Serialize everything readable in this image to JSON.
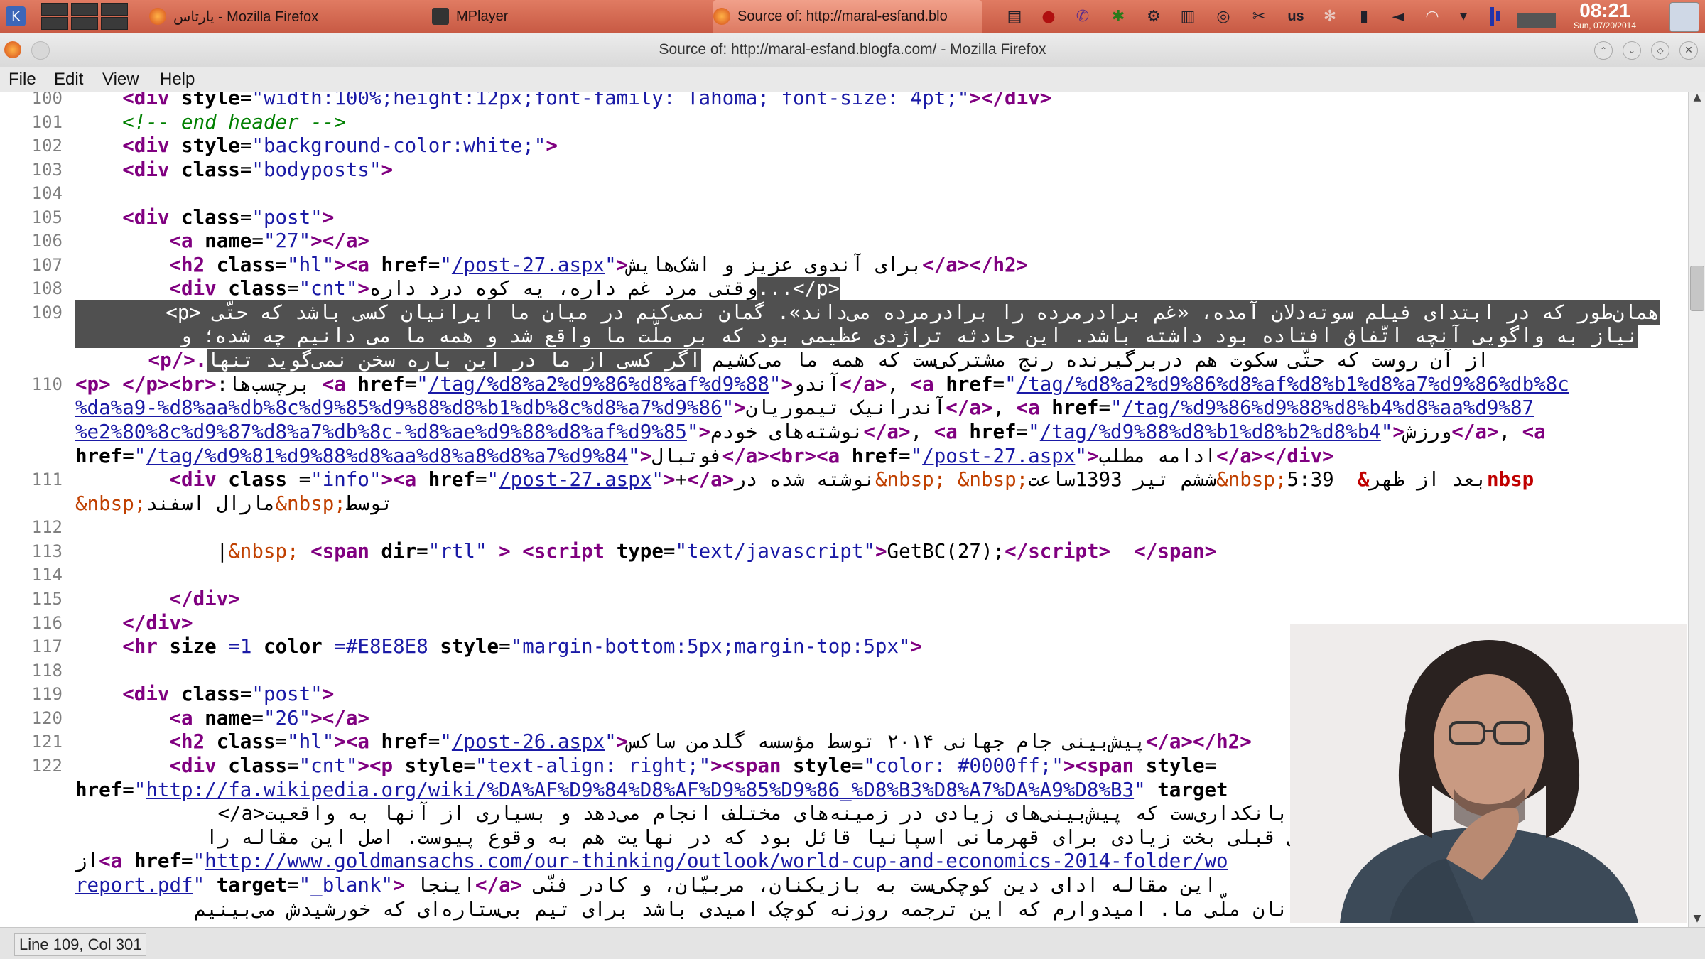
{
  "taskbar": {
    "tasks": [
      {
        "label": "یارتاس - Mozilla Firefox",
        "icon": "firefox-icon"
      },
      {
        "label": "MPlayer",
        "icon": "mplayer-icon"
      },
      {
        "label": "Source of: http://maral-esfand.blo",
        "icon": "firefox-icon"
      }
    ],
    "keyboard_layout": "us",
    "clock_time": "08:21",
    "clock_date": "Sun, 07/20/2014"
  },
  "window": {
    "title": "Source of: http://maral-esfand.blogfa.com/ - Mozilla Firefox",
    "menu": [
      "File",
      "Edit",
      "View",
      "Help"
    ]
  },
  "status": {
    "text": "Line 109, Col 301"
  },
  "gutter": [
    "100",
    "101",
    "102",
    "103",
    "104",
    "105",
    "106",
    "107",
    "108",
    "109",
    "",
    "",
    "110",
    "",
    "",
    "",
    "111",
    "",
    "112",
    "113",
    "114",
    "115",
    "116",
    "117",
    "118",
    "119",
    "120",
    "121",
    "122",
    "",
    "",
    "",
    "",
    "",
    ""
  ],
  "code": {
    "l100a": "    <div style=\"width:100%;height:12px;font-family: Tahoma; font-size: 4pt;\"></div>",
    "l101": "<!-- end header -->",
    "l102_val": "\"background-color:white;\"",
    "l103_val": "\"bodyposts\"",
    "l105_val": "\"post\"",
    "l106_val": "\"27\"",
    "l107_cls": "\"hl\"",
    "l107_href": "/post-27.aspx",
    "l107_text": "برای آندوی عزیز و اشک‌هایش",
    "l108_cls": "\"cnt\"",
    "l108_text": "وقتی مرد غم داره، یه کوه درد داره",
    "l108_sel": "...</p>",
    "l109a": "همان‌طور که در ابتدای فیلم سوته‌دلان آمده، «غم برادرمرده را برادرمرده می‌داند». گمان نمی‌کنم در میان ما ایرانیان کسی باشد که حتّی <p>",
    "l109b": "نیاز به واگویی آنچه اتّفاق افتاده بود داشته باشد. این حادثه تراژدی عظیمی بود که بر ملّت ما واقع شد و همه ما می دانیم چه شده؛ و",
    "l109c_sel": "اگر کسی از ما در این باره سخن نمی‌گوید تنها",
    "l109c_rest": "از آن روست که حتّی سکوت هم دربرگیرنده رنج مشترکی‌ست که همه ما می‌کشیم",
    "l110_tags": "برچسب‌ها:",
    "l110_h1": "/tag/%d8%a2%d9%86%d8%af%d9%88",
    "l110_t1": "آندو",
    "l110_h2a": "/tag/%d8%a2%d9%86%d8%af%d8%b1%d8%a7%d9%86%db%8c",
    "l110_h2b": "%da%a9-%d8%aa%db%8c%d9%85%d9%88%d8%b1%db%8c%d8%a7%d9%86",
    "l110_t2": "آندرانیک تیموریان",
    "l110_h3a": "/tag/%d9%86%d9%88%d8%b4%d8%aa%d9%87",
    "l110_h3b": "%e2%80%8c%d9%87%d8%a7%db%8c-%d8%ae%d9%88%d8%af%d9%85",
    "l110_t3": "نوشته‌های خودم",
    "l110_h4": "/tag/%d9%88%d8%b1%d8%b2%d8%b4",
    "l110_t4": "ورزش",
    "l110_h5": "/tag/%d9%81%d9%88%d8%aa%d8%a8%d8%a7%d9%84",
    "l110_t5": "فوتبال",
    "l110_h6": "/post-27.aspx",
    "l110_t6": "ادامه مطلب",
    "l111_cls": "\"info\"",
    "l111_href": "/post-27.aspx",
    "l111_text1": "نوشته شده در",
    "l111_text2": "ششم تیر 1393ساعت",
    "l111_time": "5:39",
    "l111_text3": "بعد از ظهر",
    "l111_nbsp": "nbsp",
    "l111b_by": "توسط",
    "l111b_name": "مارال اسفند",
    "l113_nbsp": "&nbsp;",
    "l113_dir": "\"rtl\"",
    "l113_type": "\"text/javascript\"",
    "l113_js": "GetBC(27);",
    "l117_size": "=1",
    "l117_color": "=#E8E8E8",
    "l117_style": "\"margin-bottom:5px;margin-top:5px\"",
    "l119_val": "\"post\"",
    "l120_val": "\"26\"",
    "l121_cls": "\"hl\"",
    "l121_href": "/post-26.aspx",
    "l121_text": "پیش‌بینی جام جهانی ۲۰۱۴ توسط مؤسسه گلدمن ساکس",
    "l122_cls": "\"cnt\"",
    "l122_style1": "\"text-align: right;\"",
    "l122_style2": "\"color: #0000ff;\"",
    "l122b_href": "http://fa.wikipedia.org/wiki/%DA%AF%D9%84%D8%AF%D9%85%D9%86_%D8%B3%D8%A7%DA%A9%D8%B3",
    "l122b_target": "target",
    "l122c": "</a>ساکس بانکداری‌ست که پیش‌بینی‌های زیادی در زمینه‌های مختلف انجام می‌دهد و بسیاری از آنها به واقعیت",
    "l122d": "جهانی قبلی بخت زیادی برای قهرمانی اسپانیا قائل بود که در نهایت هم به وقوع پیوست. اصل این مقاله را",
    "l122e_pre": "از",
    "l122e_href": "http://www.goldmansachs.com/our-thinking/outlook/world-cup-and-economics-2014-folder/wo",
    "l122f_href": "report.pdf",
    "l122f_target": "\"_blank\"",
    "l122f_text": "اینجا",
    "l122f_rest": "این مقاله ادای دین کوچکی‌ست به بازیکنان، مربیّان، و کادر فنّی",
    "l122g": "قهرمانان ملّی ما. امیدوارم که این ترجمه روزنه کوچک امیدی باشد برای تیم بی‌ستاره‌ای که خورشیدش می‌بینیم"
  },
  "colors": {
    "panel": "#d06a52",
    "tag": "#800080",
    "value": "#1a1aa6",
    "comment": "#008000",
    "selection": "#505050"
  }
}
